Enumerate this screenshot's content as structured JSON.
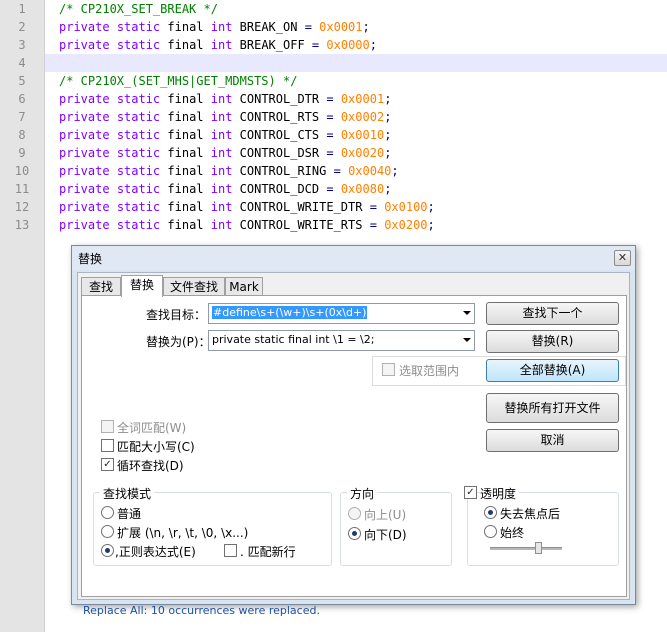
{
  "editor": {
    "line_numbers": [
      "1",
      "2",
      "3",
      "4",
      "5",
      "6",
      "7",
      "8",
      "9",
      "10",
      "11",
      "12",
      "13"
    ],
    "lines": [
      [
        {
          "c": "cm",
          "t": "/* CP210X_SET_BREAK */"
        }
      ],
      [
        {
          "c": "kw",
          "t": "private"
        },
        {
          "c": "",
          "t": " "
        },
        {
          "c": "ty",
          "t": "static"
        },
        {
          "c": "",
          "t": " final "
        },
        {
          "c": "ty",
          "t": "int"
        },
        {
          "c": "",
          "t": " BREAK_ON "
        },
        {
          "c": "op",
          "t": "="
        },
        {
          "c": "",
          "t": " "
        },
        {
          "c": "num",
          "t": "0x0001"
        },
        {
          "c": "op",
          "t": ";"
        }
      ],
      [
        {
          "c": "kw",
          "t": "private"
        },
        {
          "c": "",
          "t": " "
        },
        {
          "c": "ty",
          "t": "static"
        },
        {
          "c": "",
          "t": " final "
        },
        {
          "c": "ty",
          "t": "int"
        },
        {
          "c": "",
          "t": " BREAK_OFF "
        },
        {
          "c": "op",
          "t": "="
        },
        {
          "c": "",
          "t": " "
        },
        {
          "c": "num",
          "t": "0x0000"
        },
        {
          "c": "op",
          "t": ";"
        }
      ],
      [],
      [
        {
          "c": "cm",
          "t": "/* CP210X_(SET_MHS|GET_MDMSTS) */"
        }
      ],
      [
        {
          "c": "kw",
          "t": "private"
        },
        {
          "c": "",
          "t": " "
        },
        {
          "c": "ty",
          "t": "static"
        },
        {
          "c": "",
          "t": " final "
        },
        {
          "c": "ty",
          "t": "int"
        },
        {
          "c": "",
          "t": " CONTROL_DTR "
        },
        {
          "c": "op",
          "t": "="
        },
        {
          "c": "",
          "t": " "
        },
        {
          "c": "num",
          "t": "0x0001"
        },
        {
          "c": "op",
          "t": ";"
        }
      ],
      [
        {
          "c": "kw",
          "t": "private"
        },
        {
          "c": "",
          "t": " "
        },
        {
          "c": "ty",
          "t": "static"
        },
        {
          "c": "",
          "t": " final "
        },
        {
          "c": "ty",
          "t": "int"
        },
        {
          "c": "",
          "t": " CONTROL_RTS "
        },
        {
          "c": "op",
          "t": "="
        },
        {
          "c": "",
          "t": " "
        },
        {
          "c": "num",
          "t": "0x0002"
        },
        {
          "c": "op",
          "t": ";"
        }
      ],
      [
        {
          "c": "kw",
          "t": "private"
        },
        {
          "c": "",
          "t": " "
        },
        {
          "c": "ty",
          "t": "static"
        },
        {
          "c": "",
          "t": " final "
        },
        {
          "c": "ty",
          "t": "int"
        },
        {
          "c": "",
          "t": " CONTROL_CTS "
        },
        {
          "c": "op",
          "t": "="
        },
        {
          "c": "",
          "t": " "
        },
        {
          "c": "num",
          "t": "0x0010"
        },
        {
          "c": "op",
          "t": ";"
        }
      ],
      [
        {
          "c": "kw",
          "t": "private"
        },
        {
          "c": "",
          "t": " "
        },
        {
          "c": "ty",
          "t": "static"
        },
        {
          "c": "",
          "t": " final "
        },
        {
          "c": "ty",
          "t": "int"
        },
        {
          "c": "",
          "t": " CONTROL_DSR "
        },
        {
          "c": "op",
          "t": "="
        },
        {
          "c": "",
          "t": " "
        },
        {
          "c": "num",
          "t": "0x0020"
        },
        {
          "c": "op",
          "t": ";"
        }
      ],
      [
        {
          "c": "kw",
          "t": "private"
        },
        {
          "c": "",
          "t": " "
        },
        {
          "c": "ty",
          "t": "static"
        },
        {
          "c": "",
          "t": " final "
        },
        {
          "c": "ty",
          "t": "int"
        },
        {
          "c": "",
          "t": " CONTROL_RING "
        },
        {
          "c": "op",
          "t": "="
        },
        {
          "c": "",
          "t": " "
        },
        {
          "c": "num",
          "t": "0x0040"
        },
        {
          "c": "op",
          "t": ";"
        }
      ],
      [
        {
          "c": "kw",
          "t": "private"
        },
        {
          "c": "",
          "t": " "
        },
        {
          "c": "ty",
          "t": "static"
        },
        {
          "c": "",
          "t": " final "
        },
        {
          "c": "ty",
          "t": "int"
        },
        {
          "c": "",
          "t": " CONTROL_DCD "
        },
        {
          "c": "op",
          "t": "="
        },
        {
          "c": "",
          "t": " "
        },
        {
          "c": "num",
          "t": "0x0080"
        },
        {
          "c": "op",
          "t": ";"
        }
      ],
      [
        {
          "c": "kw",
          "t": "private"
        },
        {
          "c": "",
          "t": " "
        },
        {
          "c": "ty",
          "t": "static"
        },
        {
          "c": "",
          "t": " final "
        },
        {
          "c": "ty",
          "t": "int"
        },
        {
          "c": "",
          "t": " CONTROL_WRITE_DTR "
        },
        {
          "c": "op",
          "t": "="
        },
        {
          "c": "",
          "t": " "
        },
        {
          "c": "num",
          "t": "0x0100"
        },
        {
          "c": "op",
          "t": ";"
        }
      ],
      [
        {
          "c": "kw",
          "t": "private"
        },
        {
          "c": "",
          "t": " "
        },
        {
          "c": "ty",
          "t": "static"
        },
        {
          "c": "",
          "t": " final "
        },
        {
          "c": "ty",
          "t": "int"
        },
        {
          "c": "",
          "t": " CONTROL_WRITE_RTS "
        },
        {
          "c": "op",
          "t": "="
        },
        {
          "c": "",
          "t": " "
        },
        {
          "c": "num",
          "t": "0x0200"
        },
        {
          "c": "op",
          "t": ";"
        }
      ]
    ],
    "current_line_index": 3
  },
  "dialog": {
    "title": "替换",
    "close_icon": "close-icon",
    "tabs": [
      "查找",
      "替换",
      "文件查找",
      "Mark"
    ],
    "active_tab": "替换",
    "find_label": "查找目标：",
    "find_value": "#define\\s+(\\w+)\\s+(0x\\d+)",
    "replace_label": "替换为(P)：",
    "replace_value": "private static final int \\1 = \\2;",
    "in_selection_label": "选取范围内",
    "buttons": {
      "find_next": "查找下一个",
      "replace": "替换(R)",
      "replace_all": "全部替换(A)",
      "replace_all_open": "替换所有打开文件",
      "cancel": "取消"
    },
    "options": {
      "whole_word": "全词匹配(W)",
      "match_case": "匹配大小写(C)",
      "wrap_around": "循环查找(D)"
    },
    "search_mode": {
      "title": "查找模式",
      "normal": "普通",
      "extended": "扩展 (\\n, \\r, \\t, \\0, \\x...)",
      "regex": ",正则表达式(E)",
      "dot_newline": ". 匹配新行"
    },
    "direction": {
      "title": "方向",
      "up": "向上(U)",
      "down": "向下(D)"
    },
    "transparency": {
      "title": "透明度",
      "on_lose_focus": "失去焦点后",
      "always": "始终",
      "slider_value": 0.67
    },
    "status": "Replace All: 10 occurrences were replaced."
  }
}
